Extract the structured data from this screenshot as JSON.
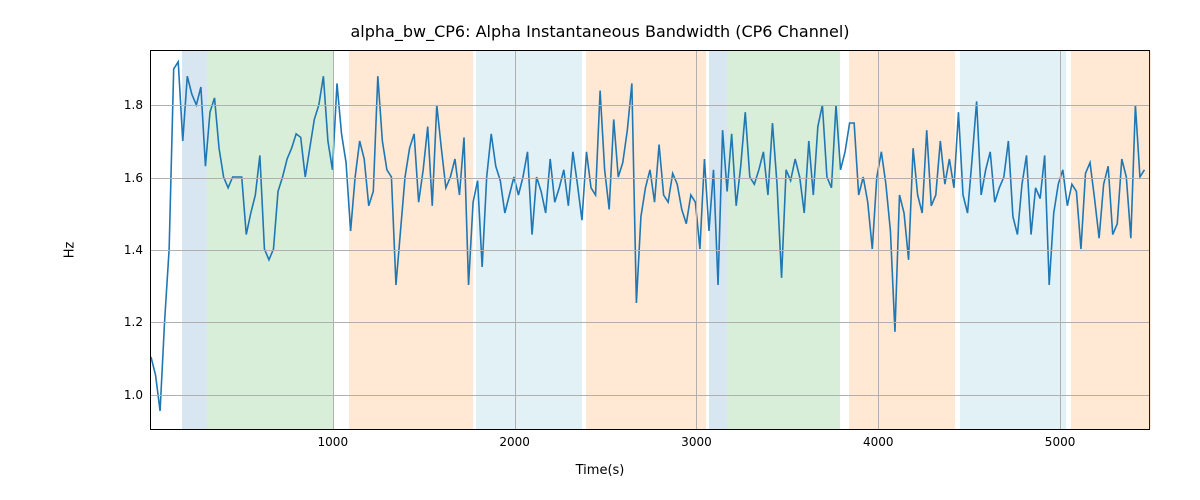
{
  "chart_data": {
    "type": "line",
    "title": "alpha_bw_CP6: Alpha Instantaneous Bandwidth (CP6 Channel)",
    "xlabel": "Time(s)",
    "ylabel": "Hz",
    "xlim": [
      0,
      5500
    ],
    "ylim": [
      0.9,
      1.95
    ],
    "yticks": [
      1.0,
      1.2,
      1.4,
      1.6,
      1.8
    ],
    "xticks": [
      1000,
      2000,
      3000,
      4000,
      5000
    ],
    "line_color": "#1f77b4",
    "bands": [
      {
        "x0": 170,
        "x1": 310,
        "color": "blue"
      },
      {
        "x0": 310,
        "x1": 1000,
        "color": "green"
      },
      {
        "x0": 1090,
        "x1": 1770,
        "color": "orange"
      },
      {
        "x0": 1790,
        "x1": 2370,
        "color": "lblue"
      },
      {
        "x0": 2390,
        "x1": 3050,
        "color": "orange"
      },
      {
        "x0": 3070,
        "x1": 3170,
        "color": "blue"
      },
      {
        "x0": 3170,
        "x1": 3790,
        "color": "green"
      },
      {
        "x0": 3840,
        "x1": 4420,
        "color": "orange"
      },
      {
        "x0": 4450,
        "x1": 5030,
        "color": "lblue"
      },
      {
        "x0": 5060,
        "x1": 5500,
        "color": "orange"
      }
    ],
    "x": [
      0,
      25,
      50,
      75,
      100,
      125,
      150,
      175,
      200,
      225,
      250,
      275,
      300,
      325,
      350,
      375,
      400,
      425,
      450,
      475,
      500,
      525,
      550,
      575,
      600,
      625,
      650,
      675,
      700,
      725,
      750,
      775,
      800,
      825,
      850,
      875,
      900,
      925,
      950,
      975,
      1000,
      1025,
      1050,
      1075,
      1100,
      1125,
      1150,
      1175,
      1200,
      1225,
      1250,
      1275,
      1300,
      1325,
      1350,
      1375,
      1400,
      1425,
      1450,
      1475,
      1500,
      1525,
      1550,
      1575,
      1600,
      1625,
      1650,
      1675,
      1700,
      1725,
      1750,
      1775,
      1800,
      1825,
      1850,
      1875,
      1900,
      1925,
      1950,
      1975,
      2000,
      2025,
      2050,
      2075,
      2100,
      2125,
      2150,
      2175,
      2200,
      2225,
      2250,
      2275,
      2300,
      2325,
      2350,
      2375,
      2400,
      2425,
      2450,
      2475,
      2500,
      2525,
      2550,
      2575,
      2600,
      2625,
      2650,
      2675,
      2700,
      2725,
      2750,
      2775,
      2800,
      2825,
      2850,
      2875,
      2900,
      2925,
      2950,
      2975,
      3000,
      3025,
      3050,
      3075,
      3100,
      3125,
      3150,
      3175,
      3200,
      3225,
      3250,
      3275,
      3300,
      3325,
      3350,
      3375,
      3400,
      3425,
      3450,
      3475,
      3500,
      3525,
      3550,
      3575,
      3600,
      3625,
      3650,
      3675,
      3700,
      3725,
      3750,
      3775,
      3800,
      3825,
      3850,
      3875,
      3900,
      3925,
      3950,
      3975,
      4000,
      4025,
      4050,
      4075,
      4100,
      4125,
      4150,
      4175,
      4200,
      4225,
      4250,
      4275,
      4300,
      4325,
      4350,
      4375,
      4400,
      4425,
      4450,
      4475,
      4500,
      4525,
      4550,
      4575,
      4600,
      4625,
      4650,
      4675,
      4700,
      4725,
      4750,
      4775,
      4800,
      4825,
      4850,
      4875,
      4900,
      4925,
      4950,
      4975,
      5000,
      5025,
      5050,
      5075,
      5100,
      5125,
      5150,
      5175,
      5200,
      5225,
      5250,
      5275,
      5300,
      5325,
      5350,
      5375,
      5400,
      5425,
      5450,
      5475,
      5500
    ],
    "y": [
      1.1,
      1.05,
      0.95,
      1.2,
      1.4,
      1.9,
      1.92,
      1.7,
      1.88,
      1.83,
      1.8,
      1.85,
      1.63,
      1.78,
      1.82,
      1.68,
      1.6,
      1.57,
      1.6,
      1.6,
      1.6,
      1.44,
      1.5,
      1.55,
      1.66,
      1.4,
      1.37,
      1.4,
      1.56,
      1.6,
      1.65,
      1.68,
      1.72,
      1.71,
      1.6,
      1.68,
      1.76,
      1.8,
      1.88,
      1.7,
      1.62,
      1.86,
      1.72,
      1.64,
      1.45,
      1.6,
      1.7,
      1.65,
      1.52,
      1.56,
      1.88,
      1.7,
      1.62,
      1.6,
      1.3,
      1.45,
      1.6,
      1.68,
      1.72,
      1.53,
      1.62,
      1.74,
      1.52,
      1.8,
      1.68,
      1.57,
      1.6,
      1.65,
      1.55,
      1.71,
      1.3,
      1.53,
      1.59,
      1.35,
      1.6,
      1.72,
      1.63,
      1.59,
      1.5,
      1.55,
      1.6,
      1.55,
      1.6,
      1.67,
      1.44,
      1.6,
      1.56,
      1.5,
      1.65,
      1.53,
      1.57,
      1.62,
      1.52,
      1.67,
      1.58,
      1.48,
      1.67,
      1.57,
      1.55,
      1.84,
      1.62,
      1.51,
      1.76,
      1.6,
      1.64,
      1.73,
      1.86,
      1.25,
      1.49,
      1.57,
      1.62,
      1.53,
      1.69,
      1.55,
      1.53,
      1.61,
      1.58,
      1.51,
      1.47,
      1.55,
      1.53,
      1.4,
      1.65,
      1.45,
      1.62,
      1.3,
      1.73,
      1.56,
      1.72,
      1.52,
      1.63,
      1.78,
      1.6,
      1.58,
      1.62,
      1.67,
      1.55,
      1.75,
      1.58,
      1.32,
      1.62,
      1.59,
      1.65,
      1.6,
      1.5,
      1.7,
      1.55,
      1.74,
      1.8,
      1.6,
      1.57,
      1.8,
      1.62,
      1.67,
      1.75,
      1.75,
      1.55,
      1.6,
      1.53,
      1.4,
      1.6,
      1.67,
      1.58,
      1.45,
      1.17,
      1.55,
      1.5,
      1.37,
      1.68,
      1.55,
      1.5,
      1.73,
      1.52,
      1.55,
      1.7,
      1.58,
      1.65,
      1.57,
      1.78,
      1.55,
      1.5,
      1.65,
      1.81,
      1.55,
      1.62,
      1.67,
      1.53,
      1.57,
      1.6,
      1.7,
      1.49,
      1.44,
      1.58,
      1.66,
      1.44,
      1.57,
      1.54,
      1.66,
      1.3,
      1.5,
      1.58,
      1.62,
      1.52,
      1.58,
      1.56,
      1.4,
      1.61,
      1.64,
      1.54,
      1.43,
      1.58,
      1.63,
      1.44,
      1.47,
      1.65,
      1.6,
      1.43,
      1.8,
      1.6,
      1.62
    ]
  }
}
